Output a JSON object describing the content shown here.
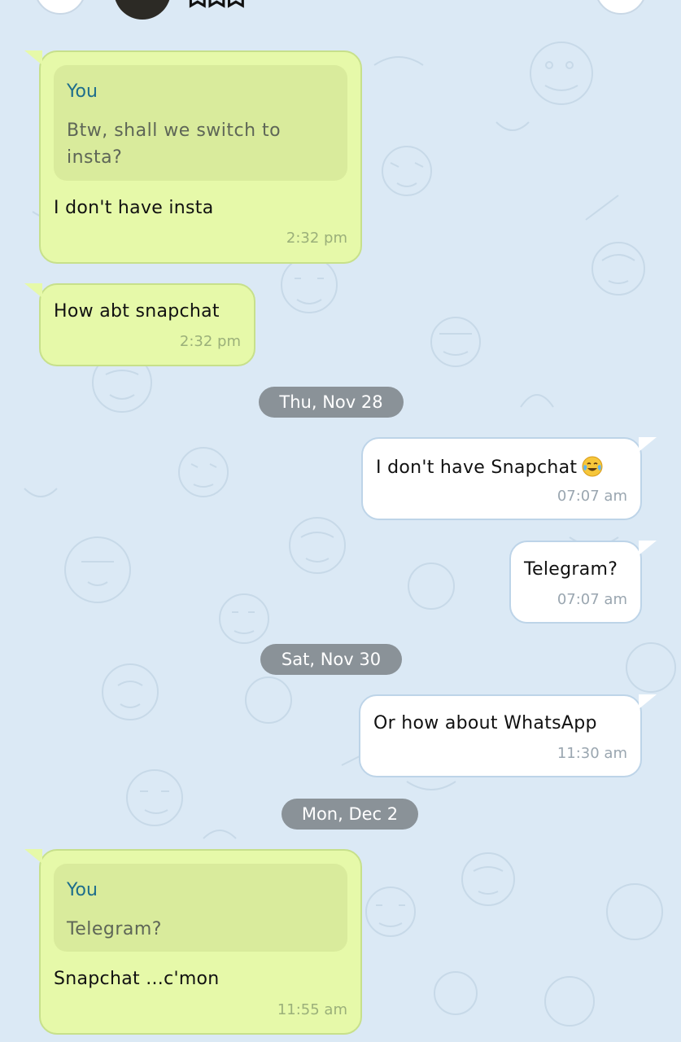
{
  "header": {
    "title_fragment": "ᗣᗣᗣ",
    "left_button_icon": "back-icon",
    "right_button_icon": "more-icon"
  },
  "colors": {
    "background": "#dbe9f5",
    "incoming_bubble": "#e6f9a9",
    "outgoing_bubble": "#ffffff",
    "quote_author": "#1d6d8c",
    "date_pill": "#8a9298"
  },
  "messages": [
    {
      "direction": "incoming",
      "reply_to": {
        "author": "You",
        "text": "Btw, shall we switch to insta?"
      },
      "text": "I don't have insta",
      "time": "2:32 pm"
    },
    {
      "direction": "incoming",
      "text": "How abt snapchat",
      "time": "2:32 pm"
    },
    {
      "direction": "outgoing",
      "text": "I don't have Snapchat",
      "emoji": "face-with-tears-of-joy-icon",
      "time": "07:07 am"
    },
    {
      "direction": "outgoing",
      "text": "Telegram?",
      "time": "07:07 am"
    },
    {
      "direction": "outgoing",
      "text": "Or how about WhatsApp",
      "time": "11:30 am"
    },
    {
      "direction": "incoming",
      "reply_to": {
        "author": "You",
        "text": "Telegram?"
      },
      "text": "Snapchat ...c'mon",
      "time": "11:55 am"
    }
  ],
  "date_separators": [
    "Thu, Nov 28",
    "Sat, Nov 30",
    "Mon, Dec 2"
  ]
}
